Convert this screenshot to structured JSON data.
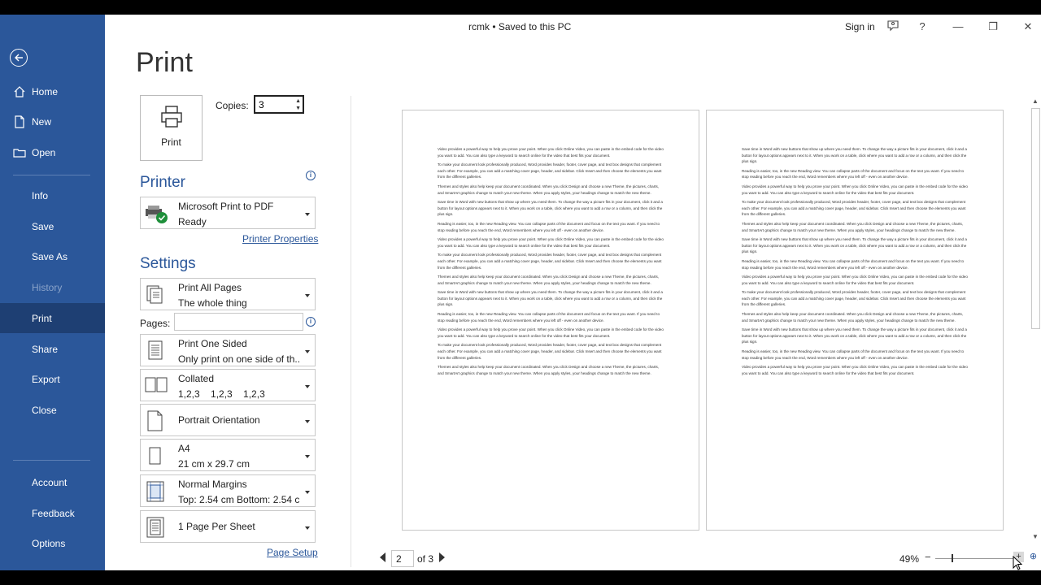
{
  "titlebar": {
    "title": "rcmk • Saved to this PC",
    "sign_in": "Sign in",
    "help": "?",
    "minimize": "—",
    "restore": "❐",
    "close": "✕"
  },
  "sidebar": {
    "items": [
      {
        "label": "Home",
        "icon": "home-icon"
      },
      {
        "label": "New",
        "icon": "new-doc-icon"
      },
      {
        "label": "Open",
        "icon": "folder-icon"
      },
      {
        "label": "Info"
      },
      {
        "label": "Save"
      },
      {
        "label": "Save As"
      },
      {
        "label": "History",
        "disabled": true
      },
      {
        "label": "Print",
        "active": true
      },
      {
        "label": "Share"
      },
      {
        "label": "Export"
      },
      {
        "label": "Close"
      },
      {
        "label": "Account"
      },
      {
        "label": "Feedback"
      },
      {
        "label": "Options"
      }
    ]
  },
  "print": {
    "page_title": "Print",
    "print_button": "Print",
    "copies_label": "Copies:",
    "copies_value": "3",
    "printer_heading": "Printer",
    "printer_name": "Microsoft Print to PDF",
    "printer_status": "Ready",
    "printer_properties": "Printer Properties",
    "settings_heading": "Settings",
    "pages_label": "Pages:",
    "page_setup": "Page Setup",
    "settings": [
      {
        "l1": "Print All Pages",
        "l2": "The whole thing"
      },
      {
        "l1": "Print One Sided",
        "l2": "Only print on one side of th..."
      },
      {
        "l1": "Collated",
        "l2": "1,2,3    1,2,3    1,2,3"
      },
      {
        "l1": "Portrait Orientation",
        "l2": ""
      },
      {
        "l1": "A4",
        "l2": "21 cm x 29.7 cm"
      },
      {
        "l1": "Normal Margins",
        "l2": "Top: 2.54 cm Bottom: 2.54 c..."
      },
      {
        "l1": "1 Page Per Sheet",
        "l2": ""
      }
    ]
  },
  "preview": {
    "page1": [
      "Video provides a powerful way to help you prove your point. When you click Online Video, you can paste in the embed code for the video you want to add. You can also type a keyword to search online for the video that best fits your document.",
      "To make your document look professionally produced, Word provides header, footer, cover page, and text box designs that complement each other. For example, you can add a matching cover page, header, and sidebar. Click Insert and then choose the elements you want from the different galleries.",
      "Themes and styles also help keep your document coordinated. When you click Design and choose a new Theme, the pictures, charts, and SmartArt graphics change to match your new theme. When you apply styles, your headings change to match the new theme.",
      "Save time in Word with new buttons that show up where you need them. To change the way a picture fits in your document, click it and a button for layout options appears next to it. When you work on a table, click where you want to add a row or a column, and then click the plus sign.",
      "Reading is easier, too, in the new Reading view. You can collapse parts of the document and focus on the text you want. If you need to stop reading before you reach the end, Word remembers where you left off - even on another device.",
      "Video provides a powerful way to help you prove your point. When you click Online Video, you can paste in the embed code for the video you want to add. You can also type a keyword to search online for the video that best fits your document.",
      "To make your document look professionally produced, Word provides header, footer, cover page, and text box designs that complement each other. For example, you can add a matching cover page, header, and sidebar. Click Insert and then choose the elements you want from the different galleries.",
      "Themes and styles also help keep your document coordinated. When you click Design and choose a new Theme, the pictures, charts, and SmartArt graphics change to match your new theme. When you apply styles, your headings change to match the new theme.",
      "Save time in Word with new buttons that show up where you need them. To change the way a picture fits in your document, click it and a button for layout options appears next to it. When you work on a table, click where you want to add a row or a column, and then click the plus sign.",
      "Reading is easier, too, in the new Reading view. You can collapse parts of the document and focus on the text you want. If you need to stop reading before you reach the end, Word remembers where you left off - even on another device.",
      "Video provides a powerful way to help you prove your point. When you click Online Video, you can paste in the embed code for the video you want to add. You can also type a keyword to search online for the video that best fits your document.",
      "To make your document look professionally produced, Word provides header, footer, cover page, and text box designs that complement each other. For example, you can add a matching cover page, header, and sidebar. Click Insert and then choose the elements you want from the different galleries.",
      "Themes and styles also help keep your document coordinated. When you click Design and choose a new Theme, the pictures, charts, and SmartArt graphics change to match your new theme. When you apply styles, your headings change to match the new theme."
    ],
    "page2": [
      "Save time in Word with new buttons that show up where you need them. To change the way a picture fits in your document, click it and a button for layout options appears next to it. When you work on a table, click where you want to add a row or a column, and then click the plus sign.",
      "Reading is easier, too, in the new Reading view. You can collapse parts of the document and focus on the text you want. If you need to stop reading before you reach the end, Word remembers where you left off - even on another device.",
      "Video provides a powerful way to help you prove your point. When you click Online Video, you can paste in the embed code for the video you want to add. You can also type a keyword to search online for the video that best fits your document.",
      "To make your document look professionally produced, Word provides header, footer, cover page, and text box designs that complement each other. For example, you can add a matching cover page, header, and sidebar. Click Insert and then choose the elements you want from the different galleries.",
      "Themes and styles also help keep your document coordinated. When you click Design and choose a new Theme, the pictures, charts, and SmartArt graphics change to match your new theme. When you apply styles, your headings change to match the new theme.",
      "Save time in Word with new buttons that show up where you need them. To change the way a picture fits in your document, click it and a button for layout options appears next to it. When you work on a table, click where you want to add a row or a column, and then click the plus sign.",
      "Reading is easier, too, in the new Reading view. You can collapse parts of the document and focus on the text you want. If you need to stop reading before you reach the end, Word remembers where you left off - even on another device.",
      "Video provides a powerful way to help you prove your point. When you click Online Video, you can paste in the embed code for the video you want to add. You can also type a keyword to search online for the video that best fits your document.",
      "To make your document look professionally produced, Word provides header, footer, cover page, and text box designs that complement each other. For example, you can add a matching cover page, header, and sidebar. Click Insert and then choose the elements you want from the different galleries.",
      "Themes and styles also help keep your document coordinated. When you click Design and choose a new Theme, the pictures, charts, and SmartArt graphics change to match your new theme. When you apply styles, your headings change to match the new theme.",
      "Save time in Word with new buttons that show up where you need them. To change the way a picture fits in your document, click it and a button for layout options appears next to it. When you work on a table, click where you want to add a row or a column, and then click the plus sign.",
      "Reading is easier, too, in the new Reading view. You can collapse parts of the document and focus on the text you want. If you need to stop reading before you reach the end, Word remembers where you left off - even on another device.",
      "Video provides a powerful way to help you prove your point. When you click Online Video, you can paste in the embed code for the video you want to add. You can also type a keyword to search online for the video that best fits your document."
    ]
  },
  "footer": {
    "page_current": "2",
    "page_of": "of 3",
    "zoom": "49%",
    "zoom_minus": "−",
    "zoom_plus": "+"
  },
  "colors": {
    "sidebar": "#2b579a",
    "sidebar_active": "#1e3f73",
    "accent": "#2b579a"
  }
}
